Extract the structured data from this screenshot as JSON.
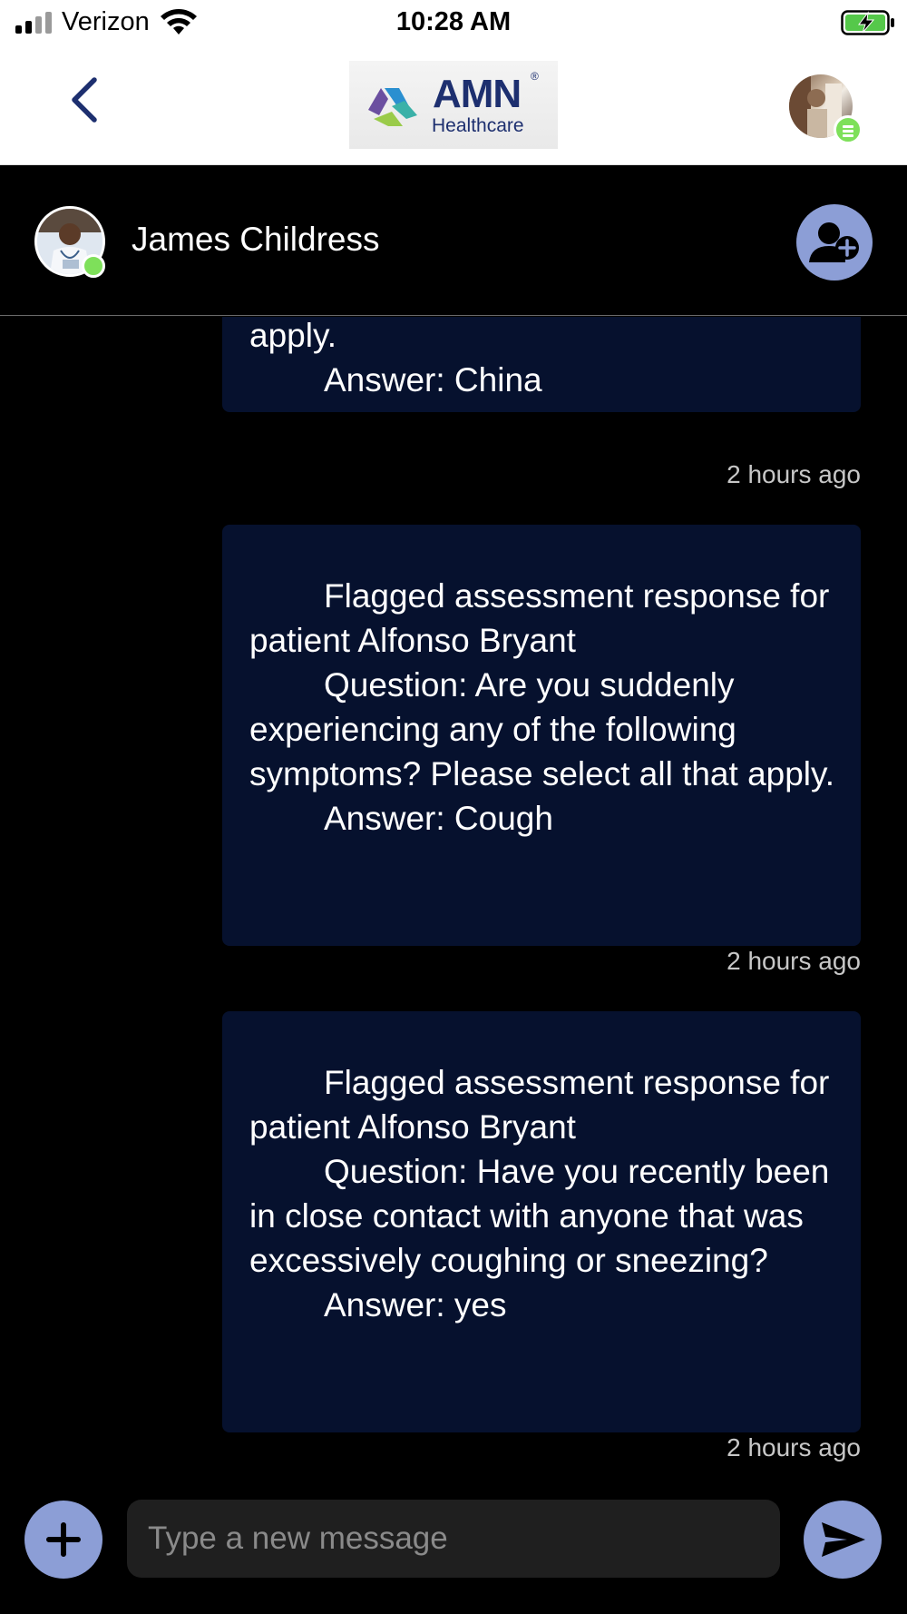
{
  "status_bar": {
    "carrier": "Verizon",
    "time": "10:28 AM",
    "signal_icon": "signal-bars-icon",
    "wifi_icon": "wifi-icon",
    "battery_icon": "battery-charging-icon"
  },
  "header": {
    "back_icon": "chevron-left-icon",
    "logo": {
      "name": "AMN",
      "registered": "®",
      "subtitle": "Healthcare"
    },
    "user_status_icon": "online-status-menu-icon"
  },
  "chat": {
    "contact_name": "James Childress",
    "contact_status": "online",
    "add_participant_icon": "add-person-icon"
  },
  "messages": [
    {
      "lines": [
        {
          "text": "apply.",
          "indent": false
        },
        {
          "text": "Answer: China",
          "indent": true
        }
      ],
      "timestamp": "2 hours ago"
    },
    {
      "lines": [
        {
          "text": "Flagged assessment response for patient Alfonso Bryant",
          "indent": true
        },
        {
          "text": "Question: Are you suddenly experiencing any of the following symptoms? Please select all that apply.",
          "indent": true
        },
        {
          "text": "Answer: Cough",
          "indent": true
        }
      ],
      "timestamp": "2 hours ago"
    },
    {
      "lines": [
        {
          "text": "Flagged assessment response for patient Alfonso Bryant",
          "indent": true
        },
        {
          "text": "Question: Have you recently been in close contact with anyone that was excessively coughing or sneezing?",
          "indent": true
        },
        {
          "text": "Answer: yes",
          "indent": true
        }
      ],
      "timestamp": "2 hours ago"
    }
  ],
  "composer": {
    "placeholder": "Type a new message",
    "value": "",
    "attach_icon": "plus-icon",
    "send_icon": "send-icon"
  },
  "colors": {
    "accent": "#8c9ed6",
    "bubble": "#06112e",
    "online": "#7ee05a",
    "brand": "#1d2f6f"
  }
}
